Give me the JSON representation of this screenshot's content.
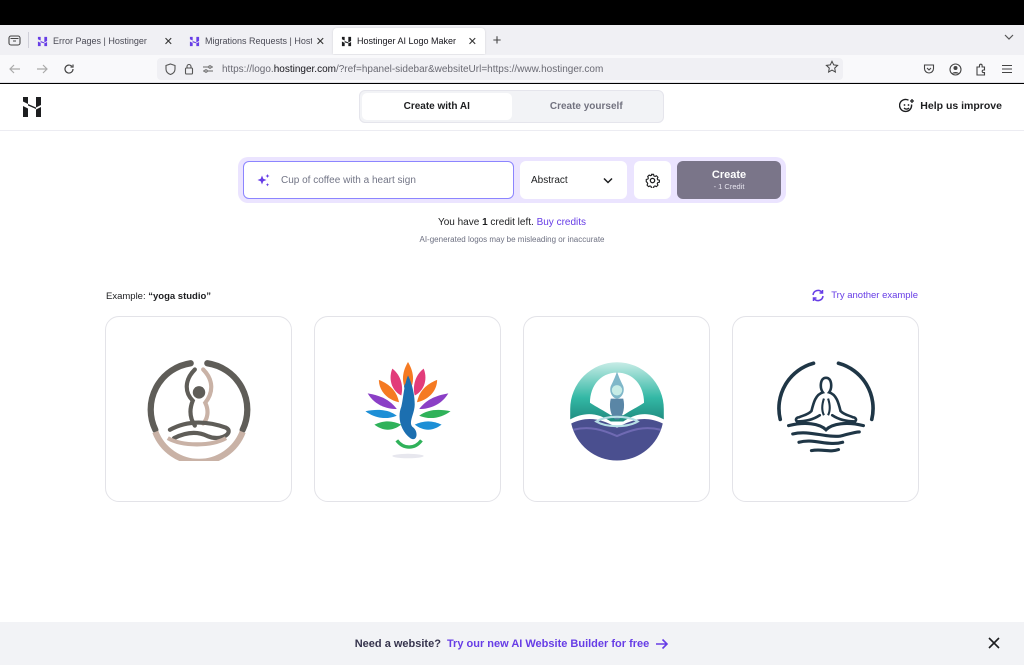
{
  "browser": {
    "tabs": [
      {
        "title": "Error Pages | Hostinger",
        "active": false
      },
      {
        "title": "Migrations Requests | Hostinger",
        "active": false
      },
      {
        "title": "Hostinger AI Logo Maker",
        "active": true
      }
    ],
    "url_prefix": "https://logo.",
    "url_domain": "hostinger.com",
    "url_suffix": "/?ref=hpanel-sidebar&websiteUrl=https://www.hostinger.com"
  },
  "header": {
    "segments": [
      {
        "label": "Create with AI",
        "active": true
      },
      {
        "label": "Create yourself",
        "active": false
      }
    ],
    "help_label": "Help us improve"
  },
  "prompt": {
    "placeholder": "Cup of coffee with a heart sign",
    "value": "",
    "style_selected": "Abstract",
    "create_label": "Create",
    "create_cost": "- 1 Credit"
  },
  "credits": {
    "prefix": "You have ",
    "count": "1",
    "suffix": " credit left. ",
    "buy_label": "Buy credits",
    "disclaimer": "AI-generated logos may be misleading or inaccurate"
  },
  "examples": {
    "label": "Example: ",
    "query": "“yoga studio”",
    "try_another_label": "Try another example",
    "logos": [
      {
        "name": "yoga-logo-earth-tone",
        "colors": [
          "#5f5d58",
          "#c9b2a6"
        ]
      },
      {
        "name": "yoga-logo-colorful-lotus",
        "colors": [
          "#e23c7a",
          "#f57a22",
          "#8b3fc6",
          "#1d8fd6",
          "#2fb25a"
        ]
      },
      {
        "name": "yoga-logo-teal-waves",
        "colors": [
          "#33b8a5",
          "#4a4f8f",
          "#7fb7c9"
        ]
      },
      {
        "name": "yoga-logo-navy-line",
        "colors": [
          "#1f3646"
        ]
      }
    ]
  },
  "banner": {
    "question": "Need a website?",
    "link": "Try our new AI Website Builder for free"
  },
  "colors": {
    "accent": "#673de6",
    "create_button": "#7a7589",
    "prompt_border": "#8c85ff"
  }
}
